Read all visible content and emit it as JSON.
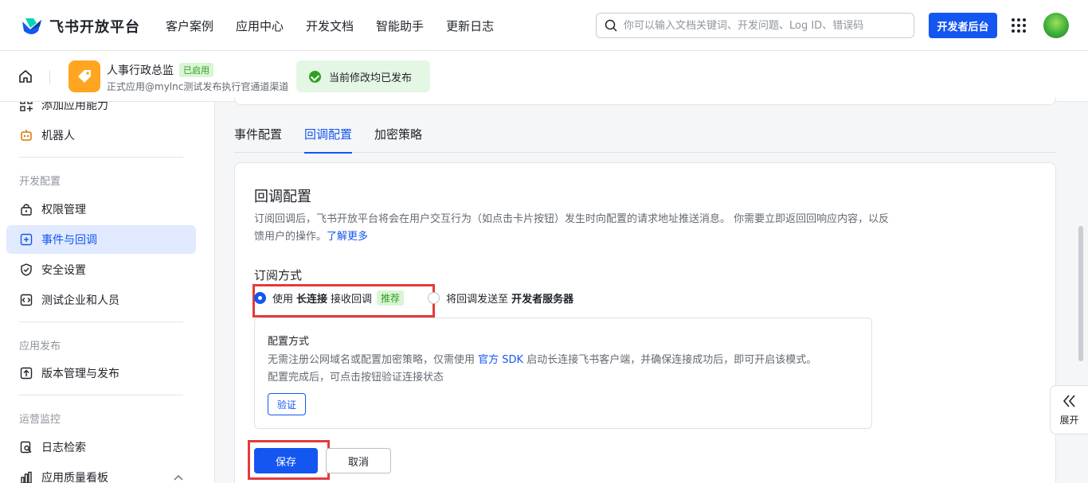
{
  "brand": {
    "name": "飞书开放平台"
  },
  "nav": {
    "items": [
      "客户案例",
      "应用中心",
      "开发文档",
      "智能助手",
      "更新日志"
    ]
  },
  "search": {
    "placeholder": "你可以输入文档关键词、开发问题、Log ID、错误码"
  },
  "dev_console": "开发者后台",
  "app": {
    "name": "人事行政总监",
    "status": "已启用",
    "subtitle": "正式应用@mylnc测试发布执行官通道渠道",
    "publish_status": "当前修改均已发布"
  },
  "sidebar": {
    "items_top": [
      {
        "label": "添加应用能力",
        "icon": "apps-add-icon"
      },
      {
        "label": "机器人",
        "icon": "robot-icon"
      }
    ],
    "groups": [
      {
        "title": "开发配置",
        "items": [
          {
            "label": "权限管理",
            "icon": "lock-icon"
          },
          {
            "label": "事件与回调",
            "icon": "event-icon",
            "active": true
          },
          {
            "label": "安全设置",
            "icon": "shield-icon"
          },
          {
            "label": "测试企业和人员",
            "icon": "code-icon"
          }
        ]
      },
      {
        "title": "应用发布",
        "items": [
          {
            "label": "版本管理与发布",
            "icon": "upload-icon"
          }
        ]
      },
      {
        "title": "运营监控",
        "items": [
          {
            "label": "日志检索",
            "icon": "log-search-icon"
          },
          {
            "label": "应用质量看板",
            "icon": "chart-icon"
          }
        ]
      }
    ]
  },
  "tabs": [
    "事件配置",
    "回调配置",
    "加密策略"
  ],
  "card": {
    "title": "回调配置",
    "desc": "订阅回调后，飞书开放平台将会在用户交互行为（如点击卡片按钮）发生时向配置的请求地址推送消息。 你需要立即返回回响应内容，以反馈用户的操作。",
    "learn_more": "了解更多",
    "subscribe_title": "订阅方式",
    "option1": {
      "pre": "使用",
      "bold": "长连接",
      "post": "接收回调",
      "tag": "推荐"
    },
    "option2": {
      "pre": "将回调发送至",
      "bold": "开发者服务器"
    },
    "config": {
      "title": "配置方式",
      "line1_pre": "无需注册公网域名或配置加密策略，仅需使用",
      "line1_link": "官方 SDK",
      "line1_post": "启动长连接飞书客户端，并确保连接成功后，即可开启该模式。",
      "line2": "配置完成后，可点击按钮验证连接状态",
      "verify": "验证"
    },
    "save": "保存",
    "cancel": "取消"
  },
  "expand_label": "展开",
  "colors": {
    "primary": "#1456f0",
    "success": "#2ea121",
    "highlight": "#e23b3b",
    "app_icon": "#ffa51f"
  }
}
